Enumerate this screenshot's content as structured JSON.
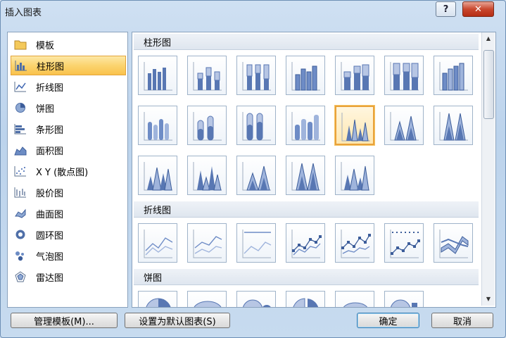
{
  "window": {
    "title": "插入图表",
    "help_label": "?",
    "close_label": "✕"
  },
  "chart_types": [
    {
      "label": "模板",
      "icon": "folder-icon"
    },
    {
      "label": "柱形图",
      "icon": "column-chart-icon",
      "selected": true
    },
    {
      "label": "折线图",
      "icon": "line-chart-icon"
    },
    {
      "label": "饼图",
      "icon": "pie-chart-icon"
    },
    {
      "label": "条形图",
      "icon": "bar-chart-icon"
    },
    {
      "label": "面积图",
      "icon": "area-chart-icon"
    },
    {
      "label": "X Y (散点图)",
      "icon": "scatter-chart-icon"
    },
    {
      "label": "股价图",
      "icon": "stock-chart-icon"
    },
    {
      "label": "曲面图",
      "icon": "surface-chart-icon"
    },
    {
      "label": "圆环图",
      "icon": "doughnut-chart-icon"
    },
    {
      "label": "气泡图",
      "icon": "bubble-chart-icon"
    },
    {
      "label": "雷达图",
      "icon": "radar-chart-icon"
    }
  ],
  "gallery": {
    "sections": [
      {
        "title": "柱形图"
      },
      {
        "title": "折线图"
      },
      {
        "title": "饼图"
      }
    ],
    "selected_thumb": "cone-3d"
  },
  "buttons": {
    "manage_templates": "管理模板(M)...",
    "set_default": "设置为默认图表(S)",
    "ok": "确定",
    "cancel": "取消"
  }
}
